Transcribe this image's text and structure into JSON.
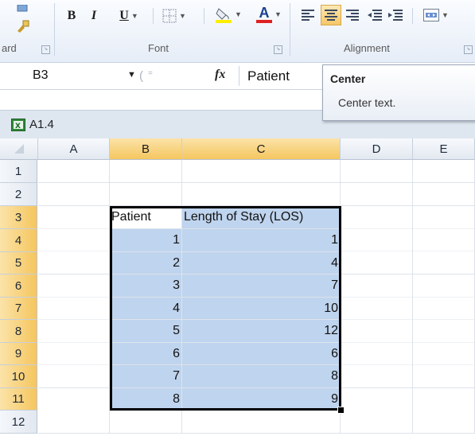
{
  "ribbon": {
    "bold": "B",
    "italic": "I",
    "underline": "U",
    "font_color_letter": "A",
    "groups": {
      "clipboard_label": "ard",
      "font_label": "Font",
      "alignment_label": "Alignment"
    }
  },
  "formula_bar": {
    "name_box": "B3",
    "fx": "fx",
    "content": "Patient"
  },
  "tooltip": {
    "title": "Center",
    "description": "Center text."
  },
  "window": {
    "title": "A1.4",
    "icon": "excel-workbook-icon"
  },
  "grid": {
    "columns": [
      "A",
      "B",
      "C",
      "D",
      "E"
    ],
    "rows": [
      "1",
      "2",
      "3",
      "4",
      "5",
      "6",
      "7",
      "8",
      "9",
      "10",
      "11",
      "12"
    ],
    "table": {
      "headers": [
        "Patient",
        "Length of Stay (LOS)"
      ],
      "rows": [
        [
          "1",
          "1"
        ],
        [
          "2",
          "4"
        ],
        [
          "3",
          "7"
        ],
        [
          "4",
          "10"
        ],
        [
          "5",
          "12"
        ],
        [
          "6",
          "6"
        ],
        [
          "7",
          "8"
        ],
        [
          "8",
          "9"
        ]
      ]
    }
  },
  "colors": {
    "selection_fill": "#bfd4ee",
    "header_highlight": "#f5c65f",
    "ribbon_bg": "#e6edf7"
  }
}
